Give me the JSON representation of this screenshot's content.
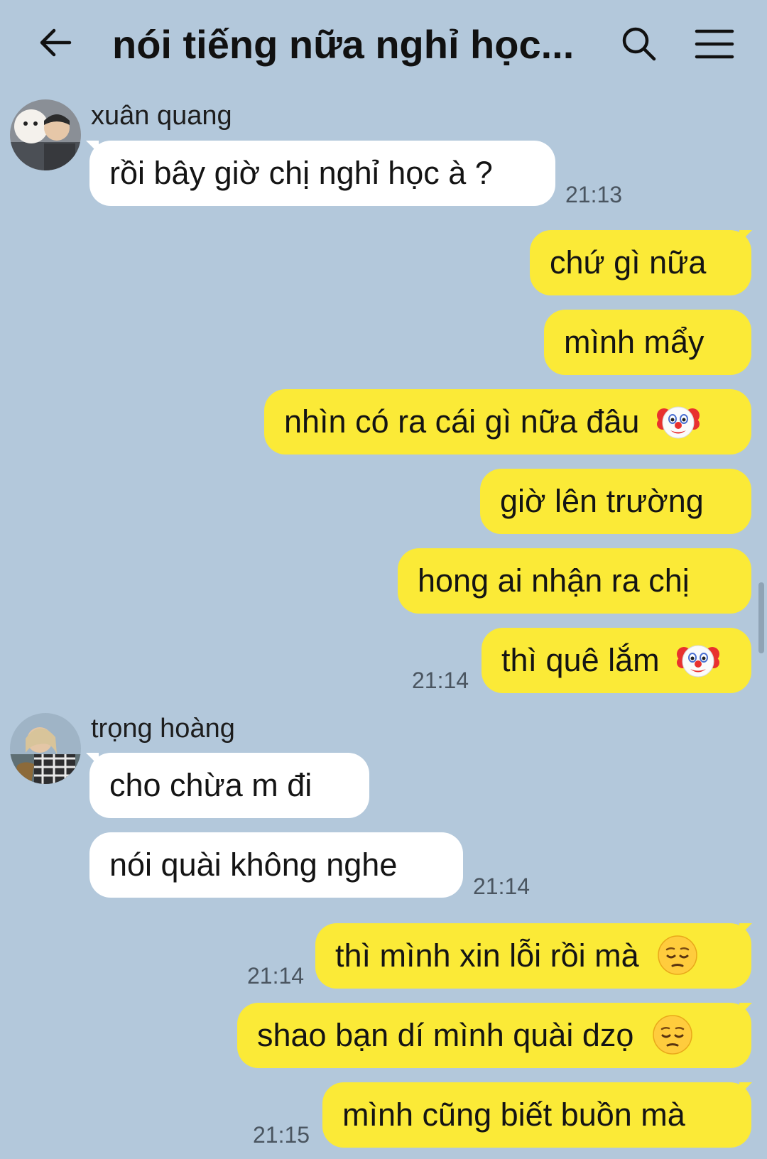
{
  "header": {
    "title": "nói tiếng nữa nghỉ học...",
    "back_icon": "arrow-left-icon",
    "search_icon": "search-icon",
    "menu_icon": "hamburger-menu-icon"
  },
  "colors": {
    "background": "#b3c8db",
    "incoming_bubble": "#ffffff",
    "outgoing_bubble": "#fbea37"
  },
  "messages": [
    {
      "direction": "in",
      "sender": "xuân quang",
      "text": "rồi bây giờ chị nghỉ học à ?",
      "time": "21:13"
    },
    {
      "direction": "out",
      "text": "chứ gì nữa"
    },
    {
      "direction": "out",
      "text": "mình mẩy"
    },
    {
      "direction": "out",
      "text": "nhìn có ra cái gì nữa đâu",
      "emoji": "clown-face-icon"
    },
    {
      "direction": "out",
      "text": "giờ lên trường"
    },
    {
      "direction": "out",
      "text": "hong ai nhận ra chị"
    },
    {
      "direction": "out",
      "text": "thì quê lắm",
      "emoji": "clown-face-icon",
      "time": "21:14"
    },
    {
      "direction": "in",
      "sender": "trọng hoàng",
      "text": "cho chừa m đi"
    },
    {
      "direction": "in",
      "text": "nói quài không nghe",
      "time": "21:14"
    },
    {
      "direction": "out",
      "text": "thì mình xin lỗi rồi mà",
      "emoji": "pensive-face-icon",
      "time": "21:14"
    },
    {
      "direction": "out",
      "text": "shao bạn dí mình quài dzọ",
      "emoji": "pensive-face-icon"
    },
    {
      "direction": "out",
      "text": "mình cũng biết buồn mà",
      "time": "21:15"
    }
  ]
}
